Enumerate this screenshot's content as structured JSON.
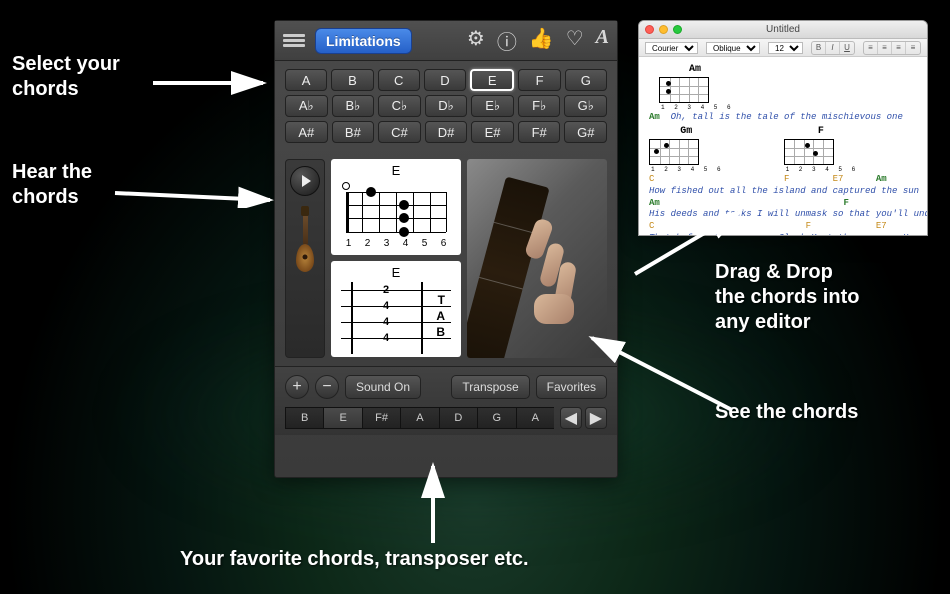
{
  "topbar": {
    "limitations_label": "Limitations"
  },
  "chord_rows": [
    [
      "A",
      "B",
      "C",
      "D",
      "E",
      "F",
      "G"
    ],
    [
      "A♭",
      "B♭",
      "C♭",
      "D♭",
      "E♭",
      "F♭",
      "G♭"
    ],
    [
      "A#",
      "B#",
      "C#",
      "D#",
      "E#",
      "F#",
      "G#"
    ]
  ],
  "selected_chord": "E",
  "diagram1": {
    "label": "E",
    "fret_numbers": [
      "1",
      "2",
      "3",
      "4",
      "5",
      "6"
    ]
  },
  "diagram2": {
    "label": "E",
    "tab_letters": [
      "T",
      "A",
      "B"
    ],
    "tab_values": [
      "2",
      "4",
      "4",
      "4"
    ]
  },
  "bottom": {
    "sound_label": "Sound On",
    "transpose_label": "Transpose",
    "favorites_label": "Favorites",
    "tuning_notes": [
      "B",
      "E",
      "F#",
      "A",
      "D",
      "G",
      "A"
    ],
    "active_tuning_index": 1
  },
  "editor": {
    "title": "Untitled",
    "font": "Courier",
    "style": "Oblique",
    "size": "12",
    "chord_a": "Am",
    "chord_b": "Gm",
    "chord_c": "F",
    "mini_nums": "1 2 3 4 5 6",
    "line1_chord": "Am",
    "line1": "Oh, tall is the tale of the mischievous one",
    "line2_inline": [
      "Am",
      "",
      "",
      "",
      "",
      "F",
      "",
      ""
    ],
    "line2_c1": "C",
    "line2_c2": "F",
    "line2_c3": "E7",
    "line2_c4": "Am",
    "line3": "How fished out all the island and captured the sun",
    "line4_c1": "Am",
    "line4_c2": "F",
    "line5": "His deeds and tasks I will unmask so that you'll understand",
    "line6_c1": "C",
    "line6_c2": "F",
    "line6_c3": "E7",
    "line7": "That before there was a Clark Kent there was a Hawaiian Super Man"
  },
  "callouts": {
    "select": "Select your\nchords",
    "hear": "Hear the\nchords",
    "favorites": "Your favorite chords, transposer  etc.",
    "see": "See the chords",
    "dragdrop": "Drag & Drop\nthe chords into\nany editor"
  }
}
